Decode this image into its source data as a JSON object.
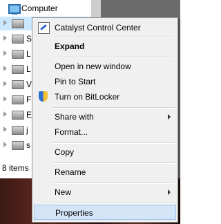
{
  "tree": {
    "root_label": "Computer",
    "rows": [
      {
        "label": ""
      },
      {
        "label": "S"
      },
      {
        "label": "L"
      },
      {
        "label": "L"
      },
      {
        "label": "V"
      },
      {
        "label": "F"
      },
      {
        "label": "E"
      },
      {
        "label": "j"
      },
      {
        "label": "s"
      }
    ],
    "items_count": "8 items"
  },
  "menu": {
    "items": {
      "ccc": "Catalyst Control Center",
      "expand": "Expand",
      "open_new_window": "Open in new window",
      "pin_to_start": "Pin to Start",
      "turn_on_bitlocker": "Turn on BitLocker",
      "share_with": "Share with",
      "format": "Format...",
      "copy": "Copy",
      "rename": "Rename",
      "new": "New",
      "properties": "Properties"
    }
  }
}
